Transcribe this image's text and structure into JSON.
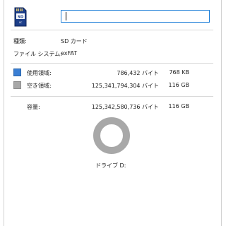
{
  "header": {
    "name_value": ""
  },
  "info": {
    "type_label": "種類:",
    "type_value": "SD カード",
    "fs_label": "ファイル システム:",
    "fs_value": "exFAT"
  },
  "space": {
    "used": {
      "label": "使用領域:",
      "bytes": "786,432 バイト",
      "size": "768 KB",
      "color": "#3a7fd4"
    },
    "free": {
      "label": "空き領域:",
      "bytes": "125,341,794,304 バイト",
      "size": "116 GB",
      "color": "#a8a8a8"
    },
    "capacity": {
      "label": "容量:",
      "bytes": "125,342,580,736 バイト",
      "size": "116 GB"
    }
  },
  "chart_data": {
    "type": "pie",
    "categories": [
      "使用領域",
      "空き領域"
    ],
    "values": [
      786432,
      125341794304
    ]
  },
  "drive_label": "ドライブ D:",
  "icons": {
    "drive": "sd-card-icon"
  }
}
